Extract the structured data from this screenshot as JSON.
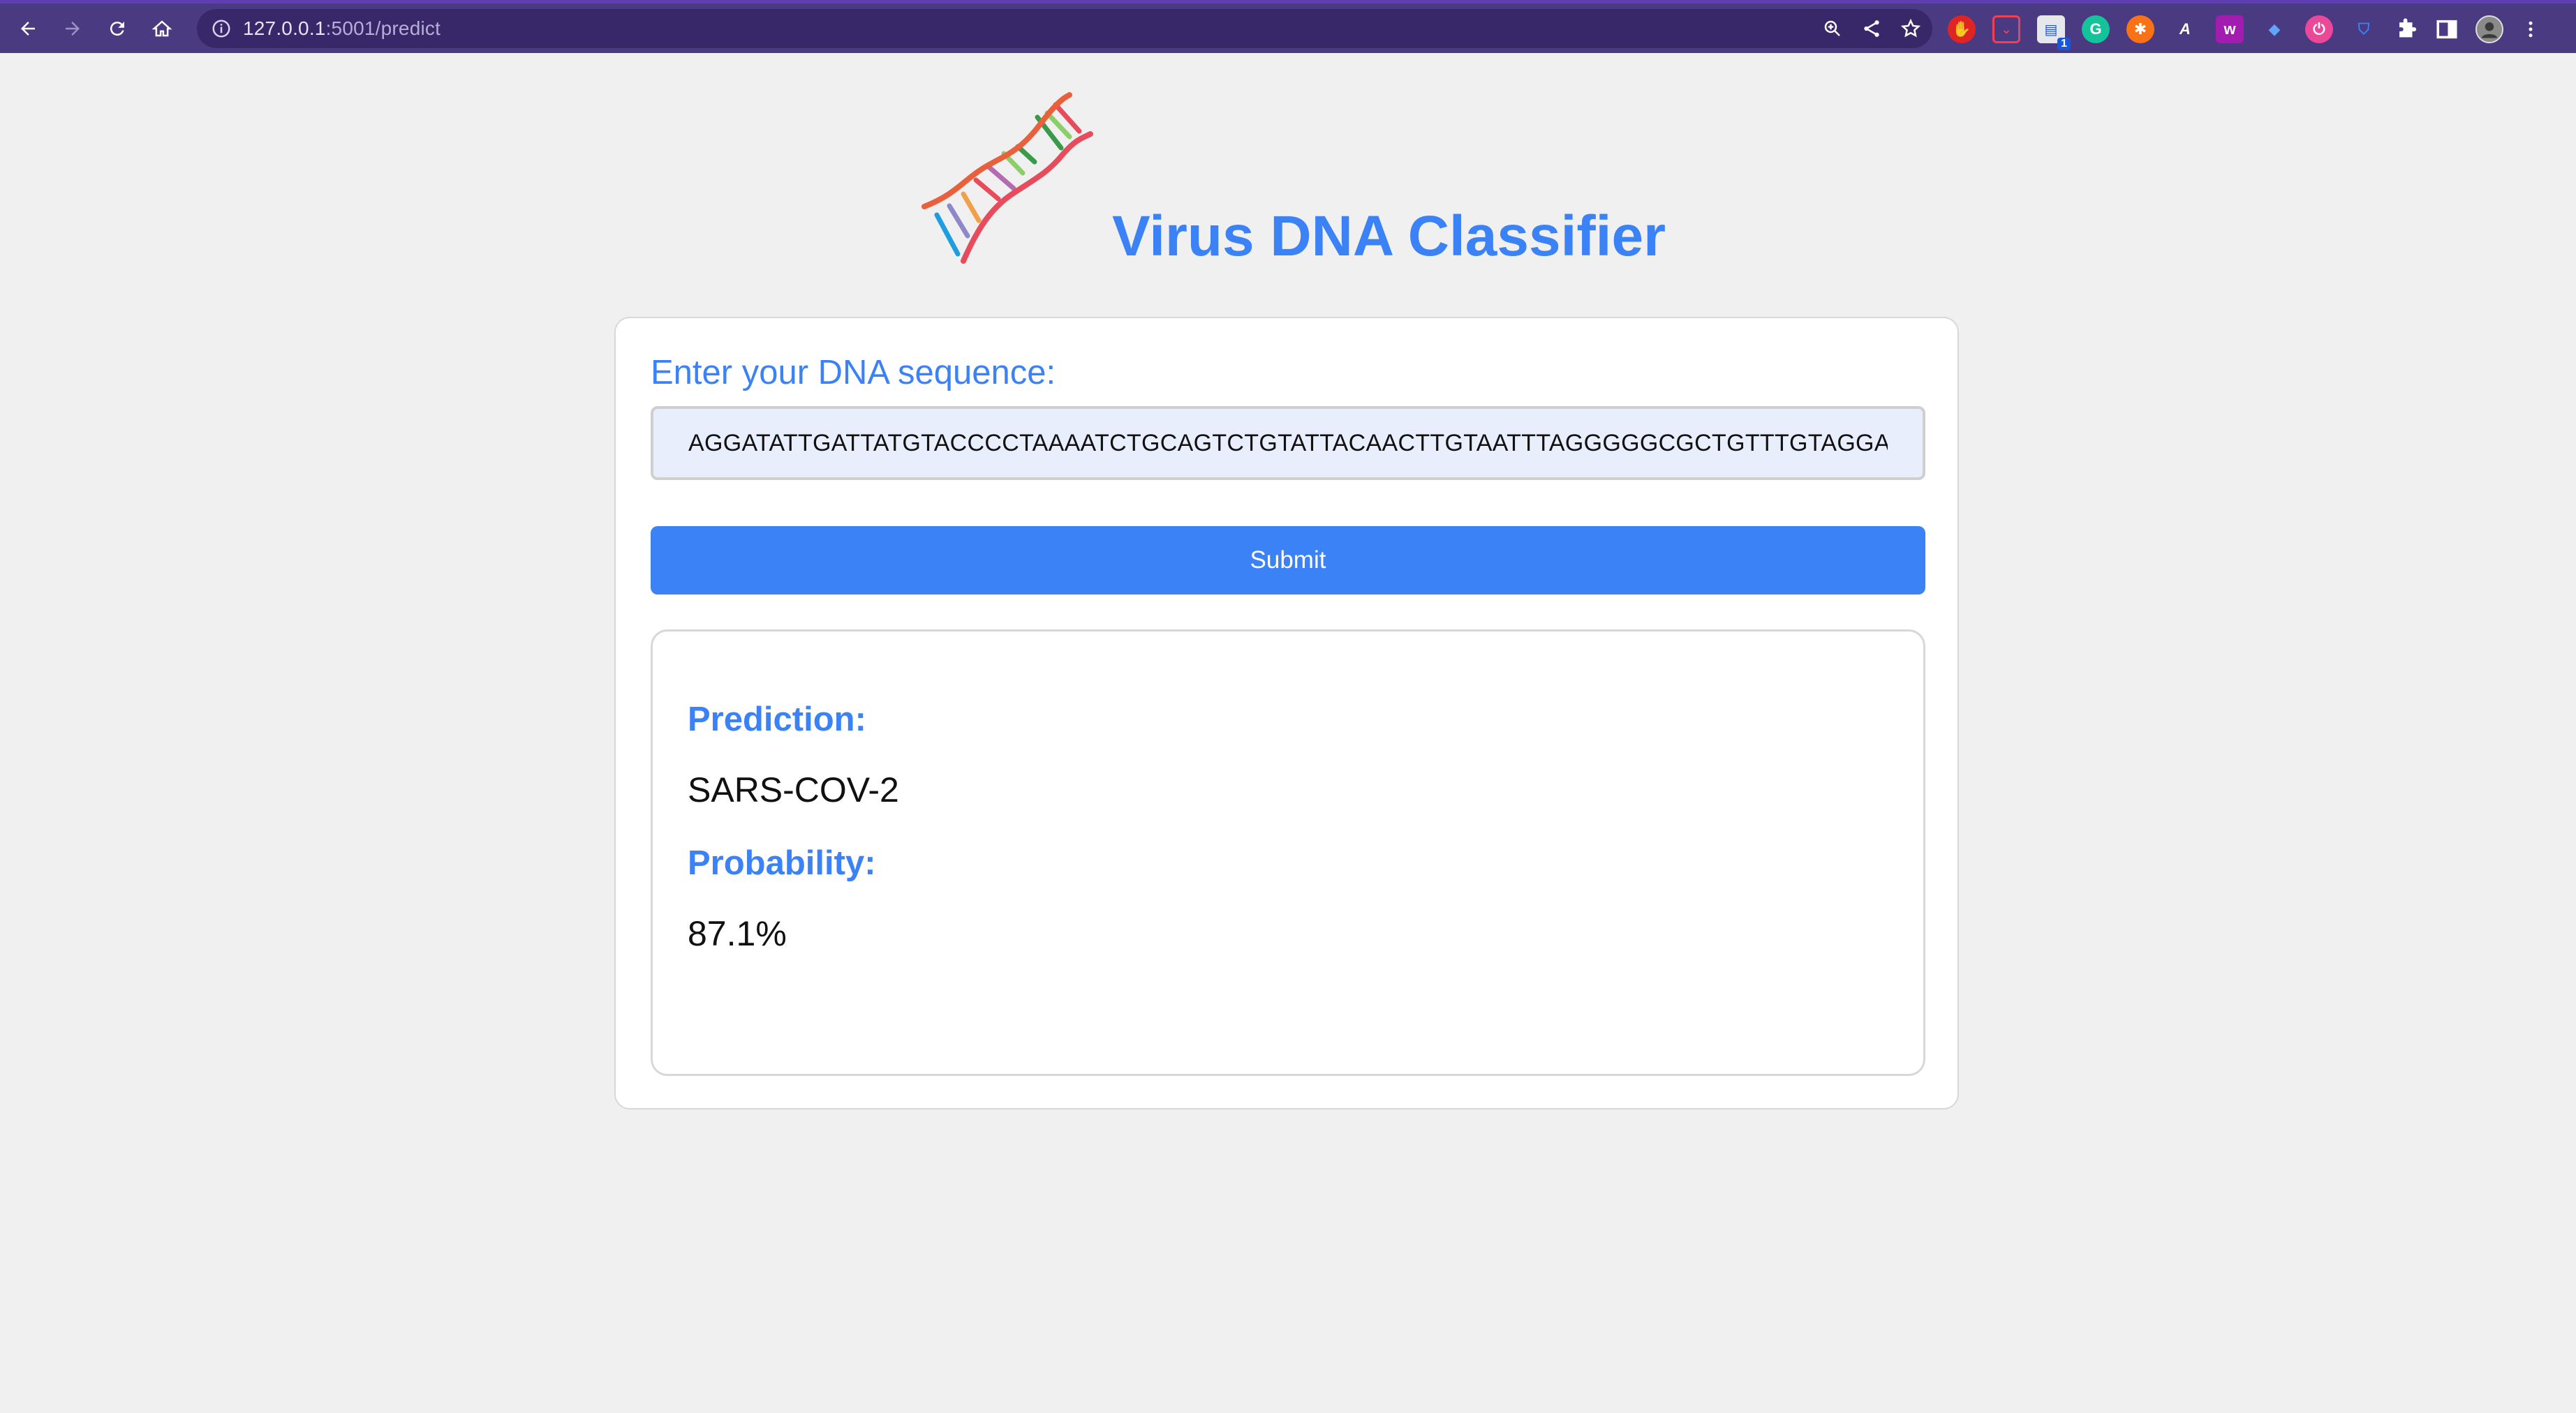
{
  "browser": {
    "url_host": "127.0.0.1",
    "url_path": ":5001/predict",
    "ext_badge_count": "1"
  },
  "header": {
    "title": "Virus DNA Classifier"
  },
  "form": {
    "label": "Enter your DNA sequence:",
    "sequence_value": "AGGATATTGATTATGTACCCCTAAAATCTGCAGTCTGTATTACAACTTGTAATTTAGGGGGCGCTGTTTGTAGGAAG",
    "submit_label": "Submit"
  },
  "result": {
    "prediction_heading": "Prediction:",
    "prediction_value": "SARS-COV-2",
    "probability_heading": "Probability:",
    "probability_value": "87.1%"
  },
  "colors": {
    "accent": "#3b82f6",
    "chrome": "#4a3a82",
    "page_bg": "#f0f0f0"
  }
}
